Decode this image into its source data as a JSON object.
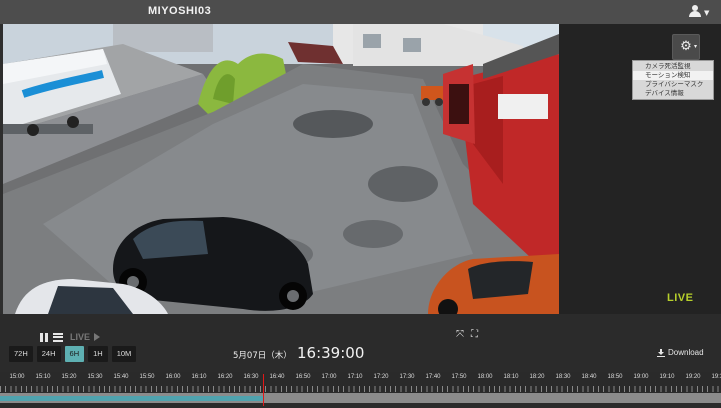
{
  "header": {
    "title": "MIYOSHI03"
  },
  "icons": {
    "user": "user-icon",
    "gear": "gear-icon",
    "pause": "pause-icon",
    "list": "list-icon",
    "play": "play-icon",
    "expand": "expand-icon",
    "fullscreen": "fullscreen-icon",
    "download": "download-icon"
  },
  "settings_menu": {
    "items": [
      "カメラ死活監視",
      "モーション検知",
      "プライバシーマスク",
      "デバイス情報"
    ],
    "selected_index": 1
  },
  "video": {
    "live_badge": "LIVE"
  },
  "controls": {
    "live_label": "LIVE",
    "ranges": [
      "72H",
      "24H",
      "6H",
      "1H",
      "10M"
    ],
    "active_range": "6H",
    "date": "5月07日（木）",
    "time": "16:39:00",
    "download_label": "Download"
  },
  "timeline": {
    "ticks": [
      "15:00",
      "15:10",
      "15:20",
      "15:30",
      "15:40",
      "15:50",
      "16:00",
      "16:10",
      "16:20",
      "16:30",
      "16:40",
      "16:50",
      "17:00",
      "17:10",
      "17:20",
      "17:30",
      "17:40",
      "17:50",
      "18:00",
      "18:10",
      "18:20",
      "18:30",
      "18:40",
      "18:50",
      "19:00",
      "19:10",
      "19:20",
      "19:30"
    ],
    "recorded_fraction": 0.365
  },
  "colors": {
    "accent": "#5eb0b2",
    "live_text": "#b6cf2b",
    "cursor": "#e01818"
  }
}
